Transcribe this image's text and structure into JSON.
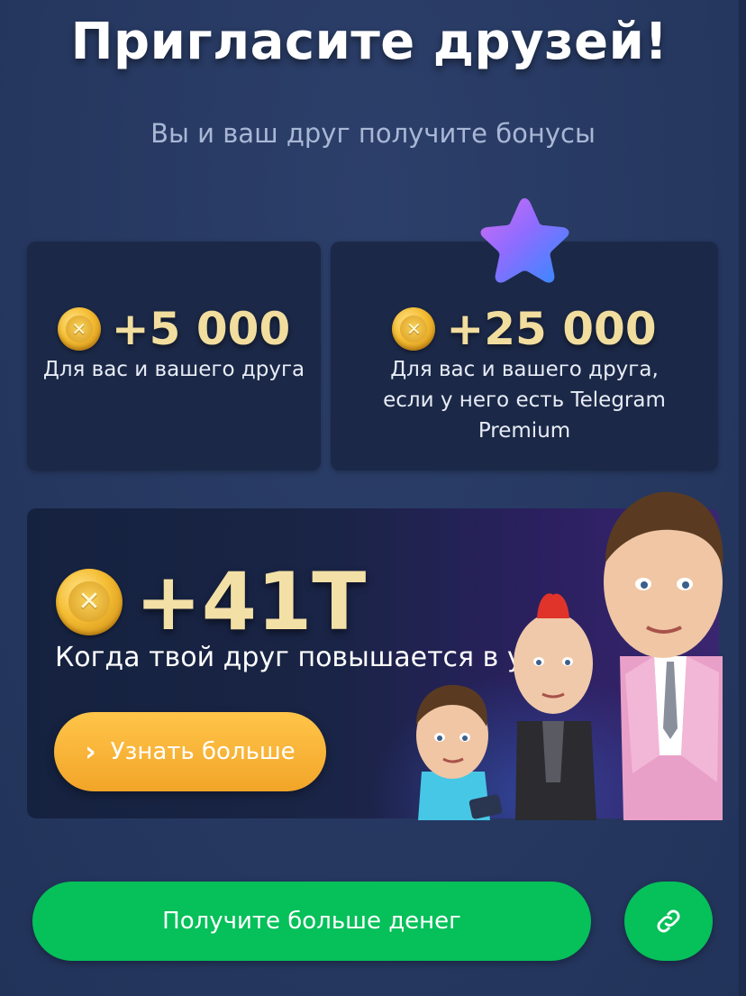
{
  "header": {
    "title": "Пригласите друзей!",
    "subtitle": "Вы и ваш друг получите бонусы"
  },
  "bonus_cards": [
    {
      "amount": "+5 000",
      "description_lines": [
        "Для вас и вашего друга"
      ]
    },
    {
      "amount": "+25 000",
      "description_lines": [
        "Для вас и вашего друга,",
        "если у него есть Telegram",
        "Premium"
      ]
    }
  ],
  "promo": {
    "amount": "+41T",
    "description": "Когда твой друг повышается в уро",
    "learn_more_label": "Узнать больше"
  },
  "actions": {
    "primary_label": "Получите больше денег",
    "link_icon": "link-icon"
  },
  "icons": {
    "coin": "coin-icon",
    "premium_star": "telegram-premium-star-icon",
    "chevron": "chevron-right-icon"
  },
  "colors": {
    "background": "#283a63",
    "card": "#1b2847",
    "accent_green": "#06c05a",
    "accent_orange": "#f2a528",
    "gold_text": "#f1dd9e"
  }
}
